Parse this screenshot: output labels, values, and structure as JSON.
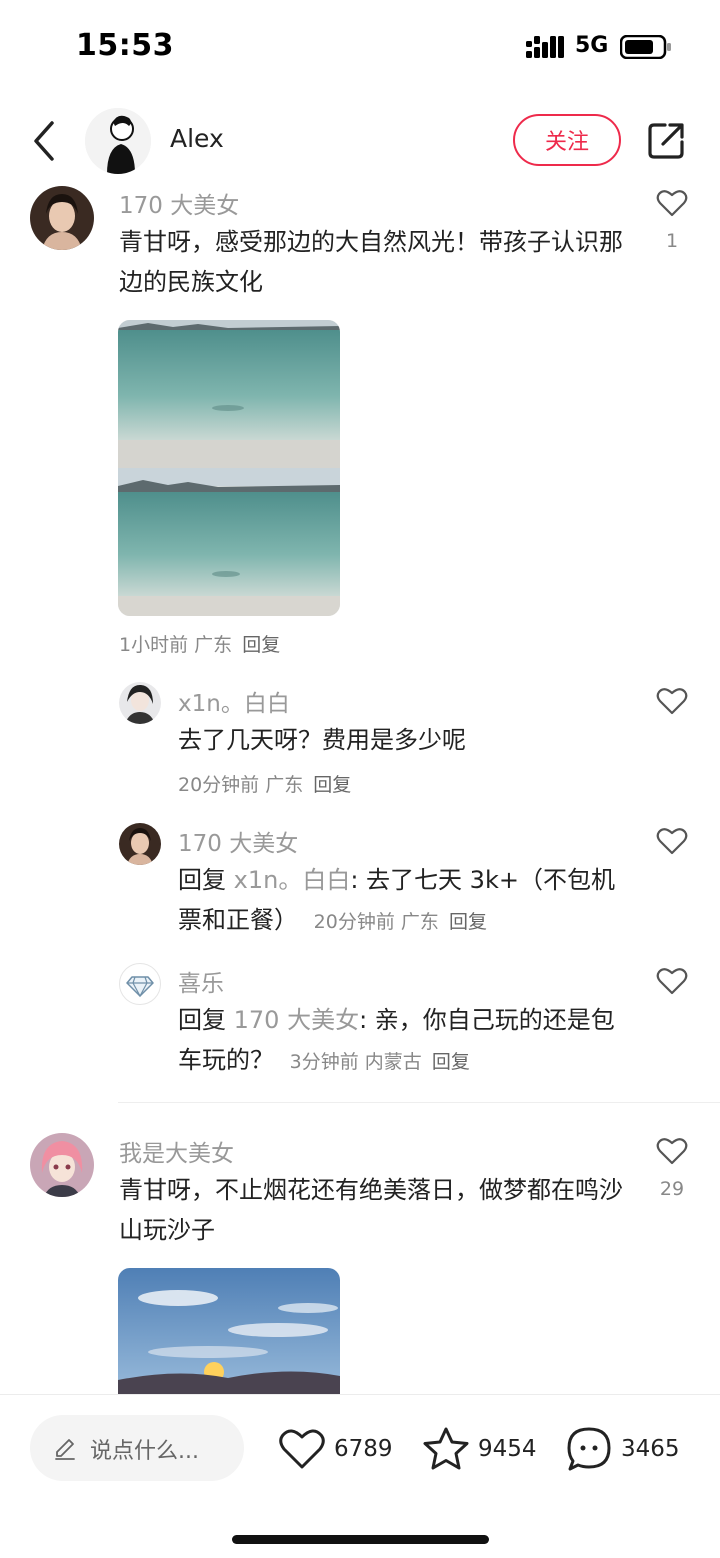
{
  "status_bar": {
    "time": "15:53",
    "network": "5G"
  },
  "header": {
    "author_name": "Alex",
    "follow_label": "关注"
  },
  "comments": [
    {
      "user": "170 大美女",
      "text": "青甘呀，感受那边的大自然风光！带孩子认识那边的民族文化",
      "likes": "1",
      "time": "1小时前",
      "location": "广东",
      "reply_label": "回复",
      "replies": [
        {
          "user": "x1n。白白",
          "text": "去了几天呀？费用是多少呢",
          "time": "20分钟前",
          "location": "广东",
          "reply_label": "回复"
        },
        {
          "user": "170 大美女",
          "reply_prefix": "回复",
          "reply_to": "x1n。白白",
          "text": ": 去了七天 3k+（不包机票和正餐）",
          "time": "20分钟前",
          "location": "广东",
          "reply_label": "回复"
        },
        {
          "user": "喜乐",
          "reply_prefix": "回复",
          "reply_to": "170 大美女",
          "text": ": 亲，你自己玩的还是包车玩的？",
          "time": "3分钟前",
          "location": "内蒙古",
          "reply_label": "回复"
        }
      ]
    },
    {
      "user": "我是大美女",
      "text": "青甘呀，不止烟花还有绝美落日，做梦都在鸣沙山玩沙子",
      "likes": "29"
    }
  ],
  "bottom_bar": {
    "input_placeholder": "说点什么...",
    "like_count": "6789",
    "favorite_count": "9454",
    "comment_count": "3465"
  },
  "colors": {
    "accent": "#ee2a4b",
    "muted_text": "#999999"
  }
}
